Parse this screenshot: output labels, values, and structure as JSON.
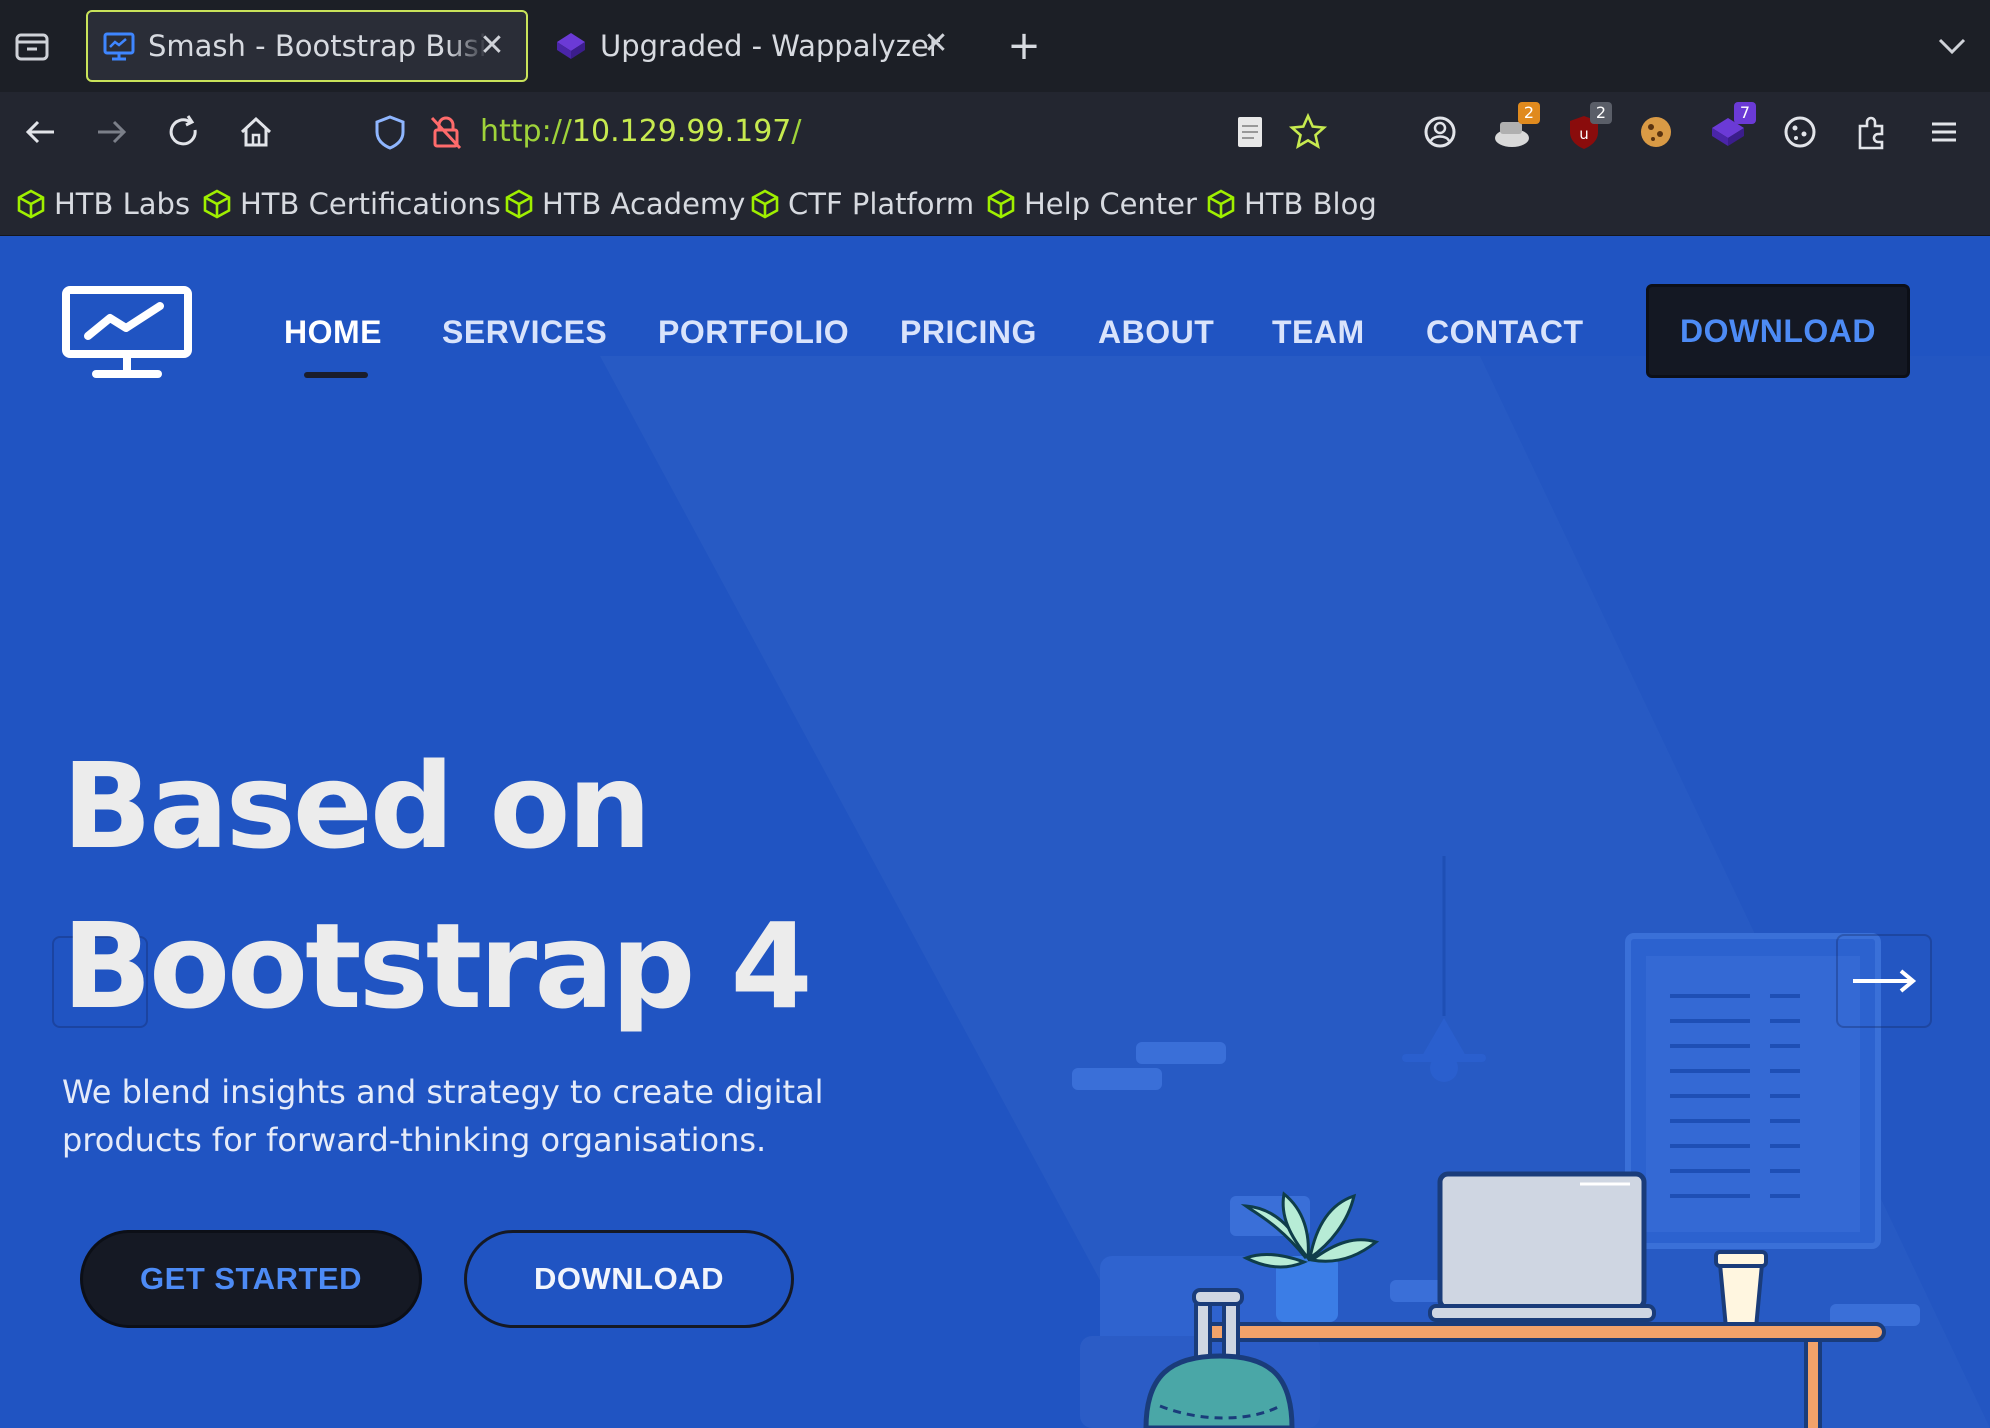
{
  "browser": {
    "tabs": [
      {
        "title": "Smash - Bootstrap Business Template",
        "active": true
      },
      {
        "title": "Upgraded - Wappalyzer",
        "active": false
      }
    ],
    "url": {
      "scheme": "http://",
      "host": "10.129.99.197",
      "path": "/"
    },
    "extension_badges": {
      "ext1": "2",
      "ublock": "2",
      "wappalyzer": "7"
    },
    "bookmarks": [
      "HTB Labs",
      "HTB Certifications",
      "HTB Academy",
      "CTF Platform",
      "Help Center",
      "HTB Blog"
    ]
  },
  "site": {
    "nav": [
      {
        "label": "HOME",
        "active": true
      },
      {
        "label": "SERVICES"
      },
      {
        "label": "PORTFOLIO"
      },
      {
        "label": "PRICING"
      },
      {
        "label": "ABOUT"
      },
      {
        "label": "TEAM"
      },
      {
        "label": "CONTACT"
      }
    ],
    "download_label": "DOWNLOAD",
    "hero": {
      "title_line1": "Based on",
      "title_line2": "Bootstrap 4",
      "subtitle": "We blend insights and strategy to create digital products for forward-thinking organisations.",
      "cta_primary": "GET STARTED",
      "cta_secondary": "DOWNLOAD"
    },
    "colors": {
      "background": "#2054c2",
      "accent": "#4d8bf5",
      "dark": "#151924"
    }
  }
}
